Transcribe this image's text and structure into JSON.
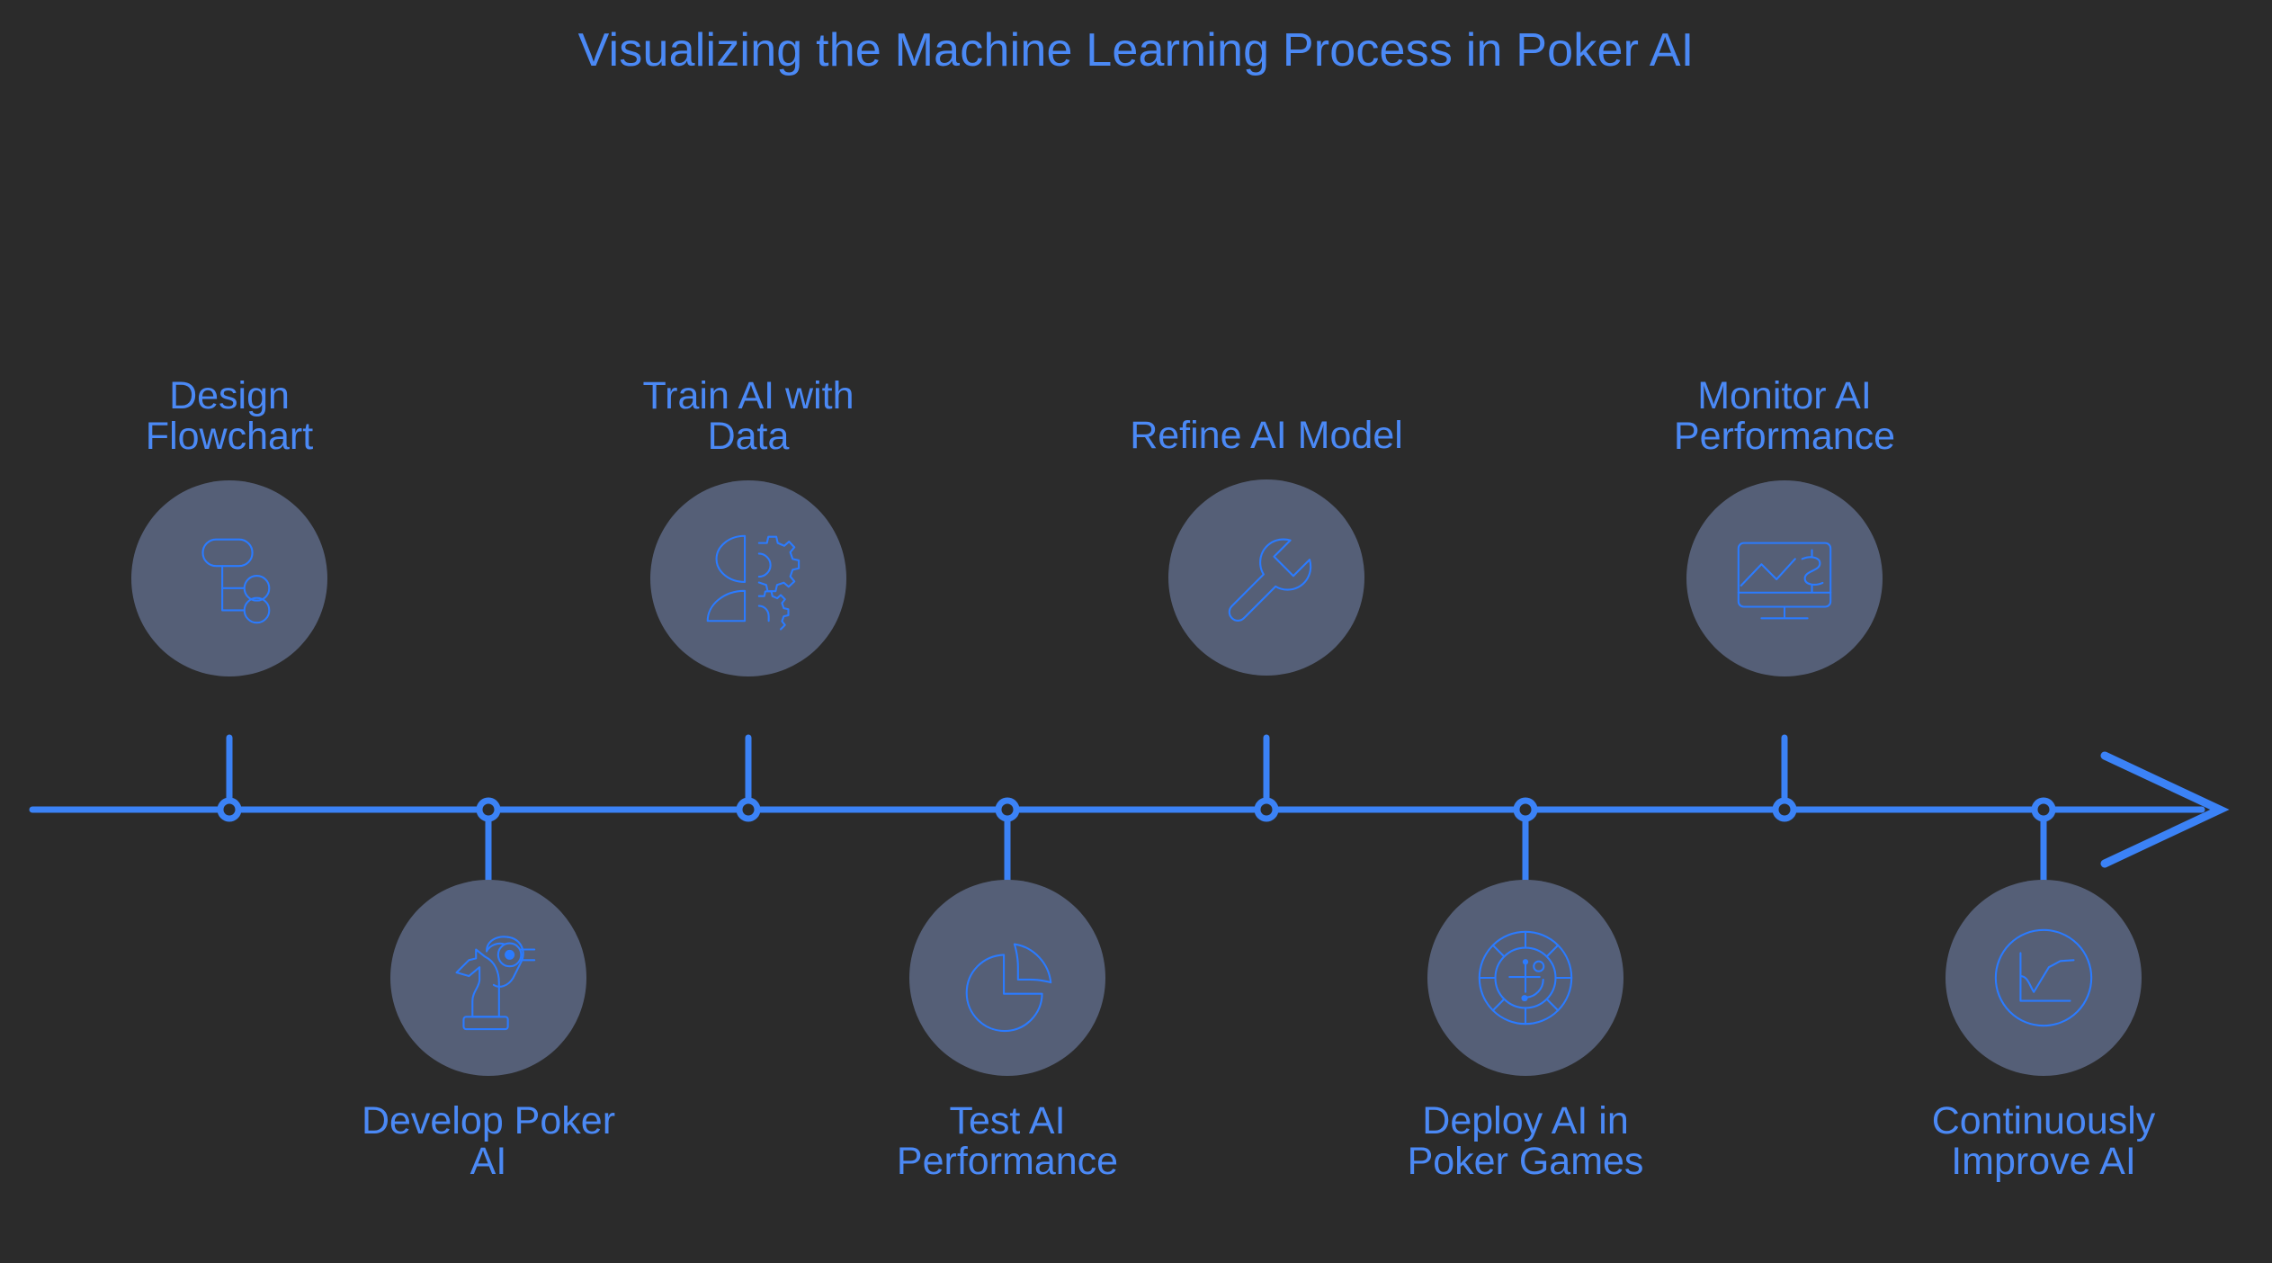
{
  "title": "Visualizing the Machine Learning Process in Poker AI",
  "colors": {
    "background": "#2b2b2b",
    "accent": "#3b82f6",
    "accent_line": "#2b7bff",
    "label_text": "#4b89f5",
    "bubble_fill": "#555f77"
  },
  "chart_data": {
    "type": "timeline",
    "title": "Visualizing the Machine Learning Process in Poker AI",
    "orientation": "horizontal",
    "axis": {
      "has_arrowhead": true,
      "direction": "left-to-right"
    },
    "steps": [
      {
        "index": 1,
        "label": "Design\nFlowchart",
        "side": "above",
        "icon": "flowchart-icon"
      },
      {
        "index": 2,
        "label": "Develop Poker\nAI",
        "side": "below",
        "icon": "chess-knight-ai-icon"
      },
      {
        "index": 3,
        "label": "Train AI with\nData",
        "side": "above",
        "icon": "head-gears-icon"
      },
      {
        "index": 4,
        "label": "Test AI\nPerformance",
        "side": "below",
        "icon": "pie-chart-icon"
      },
      {
        "index": 5,
        "label": "Refine AI Model",
        "side": "above",
        "icon": "wrench-icon"
      },
      {
        "index": 6,
        "label": "Deploy AI in\nPoker Games",
        "side": "below",
        "icon": "poker-chip-icon"
      },
      {
        "index": 7,
        "label": "Monitor AI\nPerformance",
        "side": "above",
        "icon": "monitor-chart-dollar-icon"
      },
      {
        "index": 8,
        "label": "Continuously\nImprove AI",
        "side": "below",
        "icon": "growth-circle-icon"
      }
    ]
  }
}
